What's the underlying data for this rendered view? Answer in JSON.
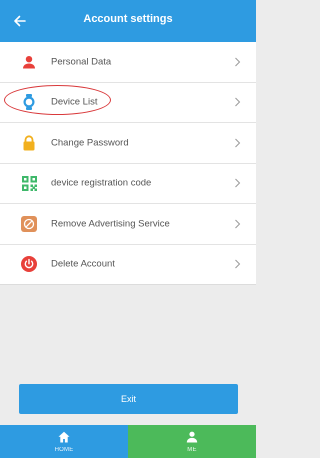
{
  "header": {
    "title": "Account settings",
    "back_icon": "arrow-left-icon"
  },
  "menu": {
    "items": [
      {
        "label": "Personal Data",
        "icon": "person-icon",
        "color": "#e8403a"
      },
      {
        "label": "Device List",
        "icon": "watch-icon",
        "color": "#2e9be1",
        "highlighted": true
      },
      {
        "label": "Change Password",
        "icon": "lock-icon",
        "color": "#f2b01e"
      },
      {
        "label": "device registration code",
        "icon": "qr-code-icon",
        "color": "#3fb86a"
      },
      {
        "label": "Remove Advertising Service",
        "icon": "ad-icon",
        "color": "#e0915a"
      },
      {
        "label": "Delete Account",
        "icon": "power-icon",
        "color": "#e8403a"
      }
    ]
  },
  "exit_button": {
    "label": "Exit"
  },
  "tabbar": {
    "home": {
      "label": "HOME",
      "icon": "home-icon",
      "color": "#2e9be1"
    },
    "me": {
      "label": "ME",
      "icon": "person-icon",
      "color": "#4cba5a"
    }
  },
  "colors": {
    "accent": "#2e9be1",
    "highlight_ring": "#d9393b"
  }
}
